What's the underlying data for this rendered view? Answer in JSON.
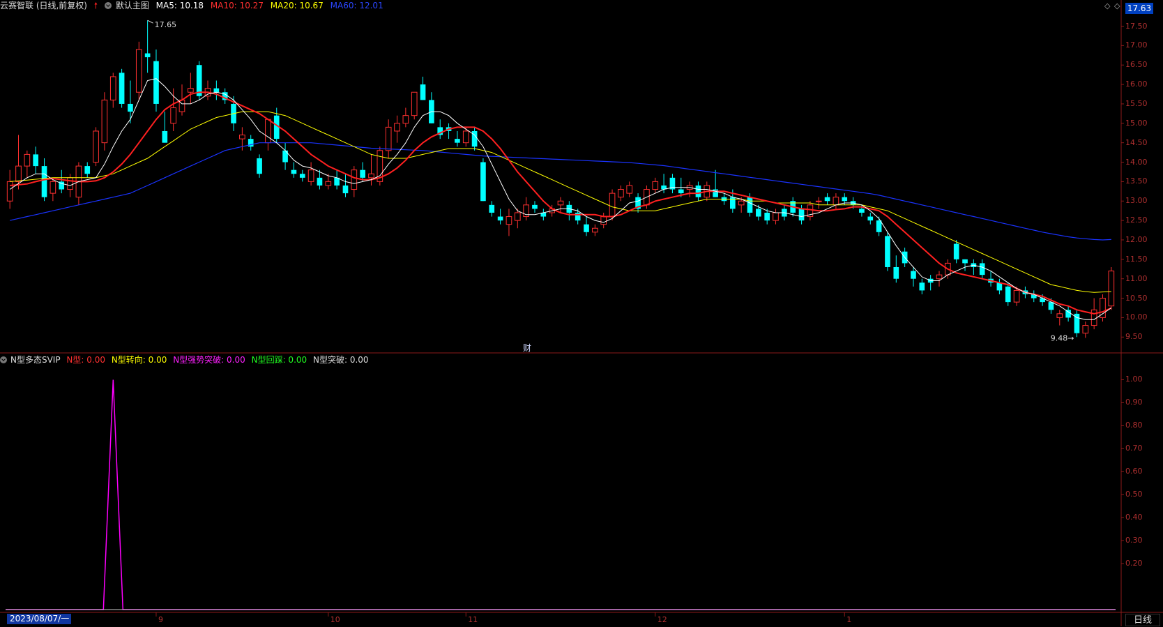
{
  "header": {
    "stock": "云赛智联 (日线,前复权)",
    "template": "默认主图",
    "ma5": "MA5: 10.18",
    "ma10": "MA10: 10.27",
    "ma20": "MA20: 10.67",
    "ma60": "MA60: 12.01",
    "current_price": "17.63"
  },
  "colors": {
    "up": "#ff3030",
    "down": "#00ffff",
    "ma5": "#ffffff",
    "ma10": "#ff2020",
    "ma20": "#ffff00",
    "ma60": "#1a33ff",
    "axis": "#b03030",
    "indicator_line": "#ff00ff"
  },
  "annotations": {
    "high": "17.65",
    "low": "9.48",
    "cai": "财"
  },
  "price_axis": [
    "17.50",
    "17.00",
    "16.50",
    "16.00",
    "15.50",
    "15.00",
    "14.50",
    "14.00",
    "13.50",
    "13.00",
    "12.50",
    "12.00",
    "11.50",
    "11.00",
    "10.50",
    "10.00",
    "9.50"
  ],
  "indicator": {
    "name": "N型多态SVIP",
    "n_type": "N型: 0.00",
    "n_turn": "N型转向: 0.00",
    "n_strong": "N型强势突破: 0.00",
    "n_back": "N型回踩: 0.00",
    "n_break": "N型突破: 0.00"
  },
  "indicator_axis": [
    "1.00",
    "0.90",
    "0.80",
    "0.70",
    "0.60",
    "0.50",
    "0.40",
    "0.30",
    "0.20"
  ],
  "date_axis": {
    "start": "2023/08/07/一",
    "months": [
      "9",
      "10",
      "11",
      "12",
      "1"
    ]
  },
  "period": "日线",
  "chart_data": {
    "type": "candlestick",
    "ohlc": [
      [
        13.0,
        13.8,
        12.8,
        13.5
      ],
      [
        13.5,
        14.7,
        13.3,
        13.9
      ],
      [
        13.9,
        14.3,
        13.6,
        14.2
      ],
      [
        14.2,
        14.4,
        13.7,
        13.9
      ],
      [
        13.9,
        14.1,
        13.0,
        13.1
      ],
      [
        13.2,
        13.6,
        13.0,
        13.5
      ],
      [
        13.5,
        13.8,
        13.2,
        13.3
      ],
      [
        13.3,
        13.7,
        13.1,
        13.6
      ],
      [
        13.1,
        14.0,
        12.9,
        13.9
      ],
      [
        13.9,
        14.0,
        13.6,
        13.7
      ],
      [
        14.0,
        14.9,
        13.9,
        14.8
      ],
      [
        14.5,
        15.8,
        14.3,
        15.6
      ],
      [
        15.6,
        16.3,
        15.4,
        16.2
      ],
      [
        16.3,
        16.4,
        15.4,
        15.5
      ],
      [
        15.5,
        16.1,
        15.0,
        15.3
      ],
      [
        15.8,
        17.1,
        15.6,
        16.9
      ],
      [
        16.8,
        17.65,
        16.3,
        16.7
      ],
      [
        16.6,
        16.9,
        15.3,
        15.5
      ],
      [
        14.8,
        15.3,
        14.5,
        14.5
      ],
      [
        15.0,
        15.9,
        14.8,
        15.4
      ],
      [
        15.3,
        16.0,
        15.2,
        15.6
      ],
      [
        15.8,
        16.3,
        15.5,
        15.9
      ],
      [
        16.5,
        16.6,
        15.6,
        15.7
      ],
      [
        15.7,
        16.1,
        15.6,
        15.9
      ],
      [
        15.9,
        16.1,
        15.6,
        15.8
      ],
      [
        15.8,
        15.9,
        15.5,
        15.6
      ],
      [
        15.5,
        15.7,
        14.8,
        15.0
      ],
      [
        14.6,
        14.9,
        14.3,
        14.7
      ],
      [
        14.6,
        14.7,
        14.3,
        14.4
      ],
      [
        14.1,
        14.2,
        13.6,
        13.7
      ],
      [
        14.5,
        15.1,
        14.3,
        15.1
      ],
      [
        15.2,
        15.4,
        14.5,
        14.6
      ],
      [
        14.3,
        14.5,
        13.8,
        14.0
      ],
      [
        13.8,
        14.0,
        13.6,
        13.7
      ],
      [
        13.7,
        13.8,
        13.5,
        13.6
      ],
      [
        13.5,
        14.0,
        13.4,
        13.8
      ],
      [
        13.6,
        13.8,
        13.3,
        13.4
      ],
      [
        13.4,
        13.7,
        13.3,
        13.5
      ],
      [
        13.6,
        13.8,
        13.3,
        13.4
      ],
      [
        13.4,
        13.7,
        13.1,
        13.2
      ],
      [
        13.3,
        13.9,
        13.1,
        13.8
      ],
      [
        13.8,
        14.0,
        13.5,
        13.6
      ],
      [
        13.6,
        14.2,
        13.4,
        13.7
      ],
      [
        13.5,
        14.4,
        13.4,
        14.3
      ],
      [
        14.3,
        15.1,
        14.1,
        14.9
      ],
      [
        14.8,
        15.2,
        14.5,
        15.0
      ],
      [
        15.0,
        15.4,
        14.9,
        15.2
      ],
      [
        15.2,
        15.8,
        15.1,
        15.8
      ],
      [
        16.0,
        16.2,
        15.6,
        15.6
      ],
      [
        15.6,
        15.8,
        15.0,
        15.0
      ],
      [
        14.9,
        15.1,
        14.6,
        14.7
      ],
      [
        14.9,
        15.0,
        14.6,
        14.8
      ],
      [
        14.6,
        14.8,
        14.4,
        14.5
      ],
      [
        14.5,
        14.9,
        14.4,
        14.8
      ],
      [
        14.8,
        14.9,
        14.3,
        14.4
      ],
      [
        14.0,
        14.1,
        13.0,
        13.0
      ],
      [
        12.9,
        13.0,
        12.6,
        12.7
      ],
      [
        12.6,
        12.8,
        12.4,
        12.5
      ],
      [
        12.4,
        12.8,
        12.1,
        12.6
      ],
      [
        12.5,
        12.8,
        12.3,
        12.7
      ],
      [
        12.6,
        13.1,
        12.5,
        12.9
      ],
      [
        12.9,
        13.0,
        12.7,
        12.8
      ],
      [
        12.7,
        12.8,
        12.5,
        12.6
      ],
      [
        12.7,
        12.9,
        12.6,
        12.8
      ],
      [
        12.9,
        13.1,
        12.7,
        13.0
      ],
      [
        12.9,
        13.0,
        12.5,
        12.7
      ],
      [
        12.7,
        12.8,
        12.4,
        12.5
      ],
      [
        12.4,
        12.6,
        12.1,
        12.2
      ],
      [
        12.2,
        12.4,
        12.1,
        12.3
      ],
      [
        12.4,
        12.7,
        12.3,
        12.6
      ],
      [
        12.6,
        13.3,
        12.5,
        13.2
      ],
      [
        13.1,
        13.4,
        13.0,
        13.3
      ],
      [
        13.2,
        13.5,
        13.1,
        13.4
      ],
      [
        13.1,
        13.2,
        12.7,
        12.8
      ],
      [
        12.9,
        13.4,
        12.8,
        13.3
      ],
      [
        13.3,
        13.6,
        13.2,
        13.5
      ],
      [
        13.4,
        13.7,
        13.2,
        13.3
      ],
      [
        13.6,
        13.7,
        13.2,
        13.3
      ],
      [
        13.3,
        13.6,
        13.1,
        13.2
      ],
      [
        13.3,
        13.5,
        13.1,
        13.4
      ],
      [
        13.4,
        13.5,
        13.0,
        13.1
      ],
      [
        13.1,
        13.5,
        13.0,
        13.4
      ],
      [
        13.3,
        13.8,
        13.1,
        13.1
      ],
      [
        13.1,
        13.2,
        12.9,
        13.0
      ],
      [
        13.1,
        13.3,
        12.7,
        12.8
      ],
      [
        12.9,
        13.1,
        12.7,
        13.0
      ],
      [
        13.1,
        13.2,
        12.6,
        12.7
      ],
      [
        12.8,
        12.9,
        12.5,
        12.6
      ],
      [
        12.7,
        12.8,
        12.4,
        12.5
      ],
      [
        12.5,
        12.8,
        12.4,
        12.7
      ],
      [
        12.8,
        12.9,
        12.5,
        12.6
      ],
      [
        13.0,
        13.1,
        12.6,
        12.7
      ],
      [
        12.8,
        12.9,
        12.4,
        12.5
      ],
      [
        12.6,
        13.0,
        12.5,
        12.9
      ],
      [
        13.0,
        13.1,
        12.8,
        13.0
      ],
      [
        13.1,
        13.2,
        12.9,
        13.0
      ],
      [
        12.9,
        13.2,
        12.8,
        13.1
      ],
      [
        13.1,
        13.2,
        12.9,
        13.0
      ],
      [
        13.0,
        13.1,
        12.8,
        12.9
      ],
      [
        12.8,
        12.9,
        12.6,
        12.7
      ],
      [
        12.6,
        12.7,
        12.4,
        12.5
      ],
      [
        12.5,
        12.6,
        12.1,
        12.2
      ],
      [
        12.1,
        12.2,
        11.2,
        11.3
      ],
      [
        11.3,
        11.6,
        10.9,
        11.0
      ],
      [
        11.7,
        11.8,
        11.3,
        11.4
      ],
      [
        11.2,
        11.3,
        10.8,
        11.0
      ],
      [
        10.9,
        11.0,
        10.6,
        10.7
      ],
      [
        11.0,
        11.1,
        10.7,
        10.9
      ],
      [
        11.0,
        11.2,
        10.8,
        11.1
      ],
      [
        11.1,
        11.5,
        11.0,
        11.4
      ],
      [
        11.9,
        12.0,
        11.4,
        11.5
      ],
      [
        11.5,
        11.5,
        11.2,
        11.4
      ],
      [
        11.4,
        11.5,
        11.1,
        11.3
      ],
      [
        11.4,
        11.5,
        11.0,
        11.1
      ],
      [
        11.0,
        11.2,
        10.8,
        10.9
      ],
      [
        10.9,
        11.0,
        10.6,
        10.7
      ],
      [
        10.8,
        10.9,
        10.3,
        10.4
      ],
      [
        10.4,
        10.8,
        10.3,
        10.7
      ],
      [
        10.7,
        10.8,
        10.5,
        10.6
      ],
      [
        10.6,
        10.7,
        10.4,
        10.5
      ],
      [
        10.5,
        10.6,
        10.3,
        10.4
      ],
      [
        10.4,
        10.5,
        10.1,
        10.2
      ],
      [
        10.0,
        10.2,
        9.8,
        10.1
      ],
      [
        10.2,
        10.3,
        9.9,
        10.0
      ],
      [
        10.1,
        10.2,
        9.5,
        9.6
      ],
      [
        9.6,
        9.9,
        9.48,
        9.8
      ],
      [
        9.8,
        10.5,
        9.7,
        10.2
      ],
      [
        10.0,
        10.6,
        9.9,
        10.5
      ],
      [
        10.3,
        11.3,
        10.2,
        11.2
      ]
    ],
    "ma5": [
      13.3,
      13.45,
      13.6,
      13.7,
      13.7,
      13.55,
      13.45,
      13.4,
      13.5,
      13.55,
      13.6,
      13.95,
      14.4,
      14.8,
      15.1,
      15.6,
      16.1,
      16.15,
      15.95,
      15.7,
      15.5,
      15.5,
      15.6,
      15.75,
      15.8,
      15.75,
      15.6,
      15.35,
      15.1,
      14.8,
      14.65,
      14.5,
      14.3,
      14.05,
      13.9,
      13.85,
      13.75,
      13.65,
      13.6,
      13.5,
      13.45,
      13.5,
      13.55,
      13.65,
      13.95,
      14.2,
      14.5,
      14.9,
      15.2,
      15.3,
      15.3,
      15.2,
      15.0,
      14.85,
      14.7,
      14.4,
      13.95,
      13.5,
      13.05,
      12.75,
      12.65,
      12.65,
      12.7,
      12.75,
      12.8,
      12.8,
      12.75,
      12.6,
      12.5,
      12.45,
      12.55,
      12.75,
      12.95,
      13.0,
      13.1,
      13.2,
      13.3,
      13.35,
      13.35,
      13.35,
      13.3,
      13.3,
      13.25,
      13.2,
      13.1,
      13.05,
      12.95,
      12.85,
      12.75,
      12.7,
      12.7,
      12.65,
      12.6,
      12.65,
      12.7,
      12.8,
      12.9,
      12.95,
      12.95,
      12.9,
      12.75,
      12.55,
      12.2,
      11.85,
      11.55,
      11.3,
      11.05,
      10.95,
      10.95,
      11.1,
      11.2,
      11.3,
      11.35,
      11.3,
      11.2,
      11.05,
      10.9,
      10.75,
      10.65,
      10.6,
      10.5,
      10.4,
      10.3,
      10.15,
      10.0,
      9.95,
      9.95,
      10.1,
      10.25
    ],
    "ma10": [
      13.4,
      13.42,
      13.44,
      13.5,
      13.55,
      13.58,
      13.55,
      13.52,
      13.5,
      13.5,
      13.52,
      13.6,
      13.75,
      13.95,
      14.2,
      14.5,
      14.8,
      15.1,
      15.35,
      15.5,
      15.6,
      15.75,
      15.8,
      15.8,
      15.75,
      15.65,
      15.55,
      15.45,
      15.35,
      15.25,
      15.1,
      14.95,
      14.8,
      14.6,
      14.4,
      14.2,
      14.05,
      13.9,
      13.8,
      13.7,
      13.6,
      13.55,
      13.55,
      13.6,
      13.7,
      13.85,
      14.05,
      14.3,
      14.5,
      14.65,
      14.75,
      14.85,
      14.9,
      14.9,
      14.9,
      14.8,
      14.6,
      14.35,
      14.05,
      13.75,
      13.5,
      13.25,
      13.0,
      12.8,
      12.7,
      12.65,
      12.65,
      12.65,
      12.65,
      12.6,
      12.6,
      12.65,
      12.75,
      12.85,
      12.9,
      13.0,
      13.05,
      13.1,
      13.15,
      13.2,
      13.2,
      13.25,
      13.25,
      13.25,
      13.2,
      13.15,
      13.1,
      13.05,
      13.0,
      12.95,
      12.9,
      12.85,
      12.8,
      12.78,
      12.75,
      12.75,
      12.78,
      12.8,
      12.85,
      12.85,
      12.8,
      12.75,
      12.6,
      12.4,
      12.2,
      12.0,
      11.8,
      11.6,
      11.4,
      11.25,
      11.15,
      11.1,
      11.05,
      11.0,
      10.95,
      10.9,
      10.85,
      10.75,
      10.65,
      10.6,
      10.55,
      10.45,
      10.35,
      10.3,
      10.2,
      10.15,
      10.1,
      10.15,
      10.25
    ],
    "ma20": [
      13.5,
      13.52,
      13.54,
      13.56,
      13.58,
      13.6,
      13.6,
      13.6,
      13.6,
      13.6,
      13.6,
      13.65,
      13.7,
      13.8,
      13.9,
      14.0,
      14.1,
      14.25,
      14.4,
      14.55,
      14.7,
      14.85,
      14.95,
      15.05,
      15.15,
      15.2,
      15.25,
      15.3,
      15.3,
      15.3,
      15.3,
      15.25,
      15.2,
      15.1,
      15.0,
      14.9,
      14.8,
      14.7,
      14.6,
      14.5,
      14.4,
      14.3,
      14.2,
      14.15,
      14.1,
      14.1,
      14.1,
      14.15,
      14.2,
      14.25,
      14.3,
      14.35,
      14.35,
      14.35,
      14.35,
      14.3,
      14.25,
      14.15,
      14.05,
      13.95,
      13.85,
      13.75,
      13.65,
      13.55,
      13.45,
      13.35,
      13.25,
      13.15,
      13.05,
      12.95,
      12.85,
      12.8,
      12.75,
      12.75,
      12.75,
      12.75,
      12.8,
      12.85,
      12.9,
      12.95,
      13.0,
      13.05,
      13.05,
      13.05,
      13.05,
      13.05,
      13.0,
      13.0,
      13.0,
      12.95,
      12.95,
      12.95,
      12.95,
      12.95,
      12.9,
      12.9,
      12.9,
      12.9,
      12.9,
      12.9,
      12.85,
      12.8,
      12.75,
      12.65,
      12.55,
      12.45,
      12.35,
      12.25,
      12.15,
      12.05,
      11.95,
      11.85,
      11.75,
      11.65,
      11.55,
      11.45,
      11.35,
      11.25,
      11.15,
      11.05,
      10.95,
      10.85,
      10.8,
      10.75,
      10.7,
      10.67,
      10.65,
      10.66,
      10.67
    ],
    "ma60": [
      12.5,
      12.55,
      12.6,
      12.65,
      12.7,
      12.75,
      12.8,
      12.85,
      12.9,
      12.95,
      13.0,
      13.05,
      13.1,
      13.15,
      13.2,
      13.3,
      13.4,
      13.5,
      13.6,
      13.7,
      13.8,
      13.9,
      14.0,
      14.1,
      14.2,
      14.3,
      14.35,
      14.4,
      14.45,
      14.5,
      14.5,
      14.5,
      14.5,
      14.5,
      14.5,
      14.5,
      14.48,
      14.46,
      14.44,
      14.42,
      14.4,
      14.38,
      14.36,
      14.35,
      14.34,
      14.33,
      14.32,
      14.31,
      14.3,
      14.28,
      14.26,
      14.24,
      14.22,
      14.2,
      14.18,
      14.16,
      14.15,
      14.14,
      14.13,
      14.12,
      14.11,
      14.1,
      14.09,
      14.08,
      14.07,
      14.06,
      14.05,
      14.04,
      14.03,
      14.02,
      14.01,
      14.0,
      13.99,
      13.97,
      13.95,
      13.93,
      13.91,
      13.88,
      13.85,
      13.82,
      13.79,
      13.76,
      13.73,
      13.7,
      13.67,
      13.64,
      13.61,
      13.58,
      13.55,
      13.52,
      13.49,
      13.46,
      13.43,
      13.4,
      13.37,
      13.34,
      13.31,
      13.28,
      13.25,
      13.22,
      13.19,
      13.15,
      13.1,
      13.05,
      13.0,
      12.95,
      12.9,
      12.85,
      12.8,
      12.75,
      12.7,
      12.65,
      12.6,
      12.55,
      12.5,
      12.45,
      12.4,
      12.35,
      12.3,
      12.25,
      12.2,
      12.16,
      12.12,
      12.08,
      12.05,
      12.03,
      12.01,
      12.0,
      12.01
    ],
    "indicator_spike_index": 12,
    "price_range": [
      9.2,
      17.85
    ],
    "indicator_range": [
      0,
      1.05
    ]
  }
}
